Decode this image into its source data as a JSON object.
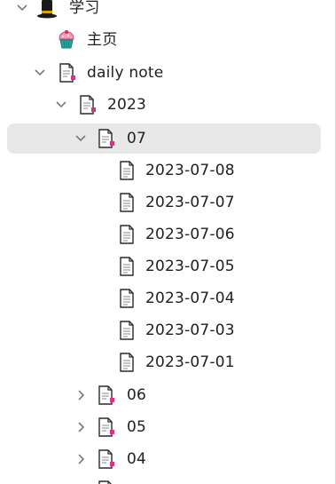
{
  "tree": {
    "root": {
      "label": "学习",
      "icon": "top-hat-icon"
    },
    "home": {
      "label": "主页",
      "icon": "cupcake-icon"
    },
    "daily_note": {
      "label": "daily note",
      "icon": "note-folder-icon"
    },
    "year_2023": {
      "label": "2023",
      "icon": "note-folder-icon"
    },
    "month_07": {
      "label": "07",
      "icon": "note-folder-icon",
      "selected": true
    },
    "notes": [
      {
        "label": "2023-07-08"
      },
      {
        "label": "2023-07-07"
      },
      {
        "label": "2023-07-06"
      },
      {
        "label": "2023-07-05"
      },
      {
        "label": "2023-07-04"
      },
      {
        "label": "2023-07-03"
      },
      {
        "label": "2023-07-01"
      }
    ],
    "months": [
      {
        "label": "06"
      },
      {
        "label": "05"
      },
      {
        "label": "04"
      }
    ]
  },
  "colors": {
    "selection": "#e8e8e8",
    "text": "#1f1f1f",
    "chevron": "#7a7a7a",
    "icon_accent": "#d63384"
  }
}
